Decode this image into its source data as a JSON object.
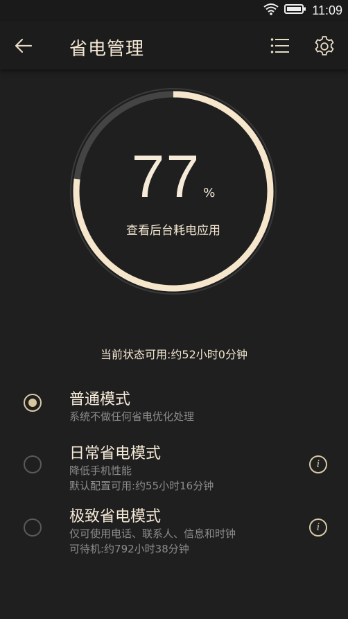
{
  "status_bar": {
    "time": "11:09",
    "wifi_icon": "wifi-icon",
    "battery_icon": "battery-icon"
  },
  "app_bar": {
    "title": "省电管理",
    "back_icon": "back-arrow-icon",
    "menu_icon": "list-icon",
    "settings_icon": "gear-icon"
  },
  "battery": {
    "percent_value": "77",
    "percent_sign": "%",
    "level": 0.77,
    "link_label": "查看后台耗电应用"
  },
  "current_status": "当前状态可用:约52小时0分钟",
  "modes": [
    {
      "title": "普通模式",
      "lines": [
        "系统不做任何省电优化处理"
      ],
      "selected": true,
      "has_info": false
    },
    {
      "title": "日常省电模式",
      "lines": [
        "降低手机性能",
        "默认配置可用:约55小时16分钟"
      ],
      "selected": false,
      "has_info": true
    },
    {
      "title": "极致省电模式",
      "lines": [
        "仅可使用电话、联系人、信息和时钟",
        "可待机:约792小时38分钟"
      ],
      "selected": false,
      "has_info": true
    }
  ],
  "colors": {
    "accent": "#f6e6cc",
    "track": "#444444",
    "background": "#1f1f1f"
  }
}
